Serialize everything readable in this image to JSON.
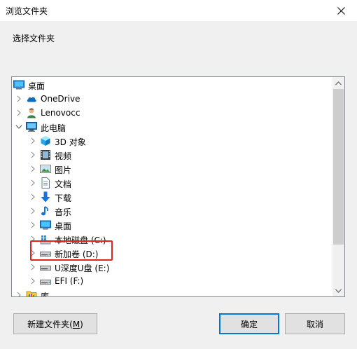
{
  "window": {
    "title": "浏览文件夹"
  },
  "instruction": "选择文件夹",
  "tree": {
    "items": [
      {
        "label": "桌面",
        "icon": "desktop-icon",
        "expander": "none"
      },
      {
        "label": "OneDrive",
        "icon": "cloud-icon",
        "expander": "collapsed"
      },
      {
        "label": "Lenovocc",
        "icon": "user-icon",
        "expander": "collapsed"
      },
      {
        "label": "此电脑",
        "icon": "computer-icon",
        "expander": "expanded"
      },
      {
        "label": "3D 对象",
        "icon": "3d-objects-icon",
        "expander": "collapsed"
      },
      {
        "label": "视频",
        "icon": "video-icon",
        "expander": "collapsed"
      },
      {
        "label": "图片",
        "icon": "pictures-icon",
        "expander": "collapsed"
      },
      {
        "label": "文档",
        "icon": "document-icon",
        "expander": "collapsed"
      },
      {
        "label": "下载",
        "icon": "download-icon",
        "expander": "collapsed"
      },
      {
        "label": "音乐",
        "icon": "music-icon",
        "expander": "collapsed"
      },
      {
        "label": "桌面",
        "icon": "desktop-icon",
        "expander": "collapsed"
      },
      {
        "label": "本地磁盘 (C:)",
        "icon": "windows-drive-icon",
        "expander": "collapsed"
      },
      {
        "label": "新加卷 (D:)",
        "icon": "drive-icon",
        "expander": "collapsed",
        "highlighted": true
      },
      {
        "label": "U深度U盘 (E:)",
        "icon": "usb-drive-icon",
        "expander": "collapsed"
      },
      {
        "label": "EFI (F:)",
        "icon": "drive-icon",
        "expander": "collapsed"
      },
      {
        "label": "库",
        "icon": "library-icon",
        "expander": "collapsed"
      }
    ]
  },
  "buttons": {
    "new_folder": {
      "label": "新建文件夹(",
      "mnemonic": "M",
      "suffix": ")"
    },
    "ok": "确定",
    "cancel": "取消"
  },
  "colors": {
    "highlight_border": "#e0241e",
    "default_button_border": "#0078d7"
  }
}
